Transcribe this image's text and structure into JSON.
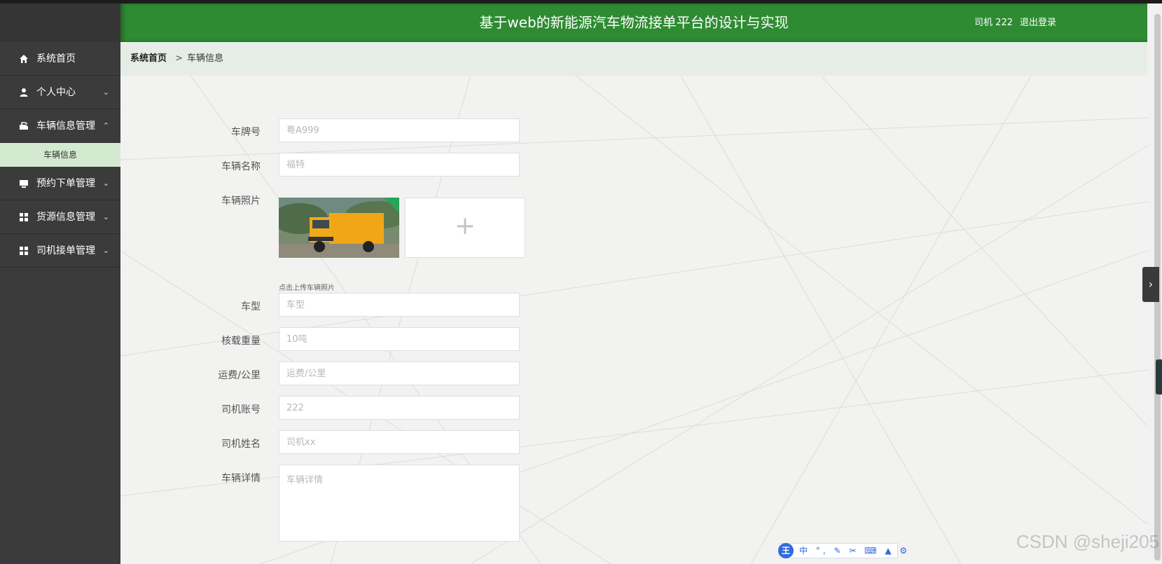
{
  "header": {
    "title": "基于web的新能源汽车物流接单平台的设计与实现",
    "user": "司机 222",
    "logout": "退出登录"
  },
  "sidebar": {
    "items": [
      {
        "label": "系统首页",
        "icon": "home-icon"
      },
      {
        "label": "个人中心",
        "icon": "user-icon",
        "chevron": "down"
      },
      {
        "label": "车辆信息管理",
        "icon": "vehicle-icon",
        "chevron": "up"
      },
      {
        "label": "预约下单管理",
        "icon": "monitor-icon",
        "chevron": "down"
      },
      {
        "label": "货源信息管理",
        "icon": "grid-icon",
        "chevron": "down"
      },
      {
        "label": "司机接单管理",
        "icon": "grid-icon",
        "chevron": "down"
      }
    ],
    "subitems": [
      {
        "label": "车辆信息",
        "active": true
      }
    ]
  },
  "breadcrumb": {
    "home": "系统首页",
    "separator": ">",
    "current": "车辆信息"
  },
  "form": {
    "plate": {
      "label": "车牌号",
      "placeholder": "粤A999"
    },
    "name": {
      "label": "车辆名称",
      "placeholder": "福特"
    },
    "photo": {
      "label": "车辆照片",
      "tip": "点击上传车辆照片",
      "upload_glyph": "+"
    },
    "type": {
      "label": "车型",
      "placeholder": "车型"
    },
    "load": {
      "label": "核载重量",
      "placeholder": "10吨"
    },
    "fee": {
      "label": "运费/公里",
      "placeholder": "运费/公里"
    },
    "account": {
      "label": "司机账号",
      "placeholder": "222"
    },
    "driver": {
      "label": "司机姓名",
      "placeholder": "司机xx"
    },
    "detail": {
      "label": "车辆详情",
      "placeholder": "车辆详情"
    }
  },
  "ime": {
    "logo": "王",
    "icons": "中 °, ✎ ✂ ⌨ ▲ ⚙"
  },
  "watermark": "CSDN @sheji205",
  "colors": {
    "header": "#2e8b32",
    "sidebar": "#3b3b3b",
    "submenu_active": "#d4ead0",
    "breadcrumb_bg": "#e6ede7"
  }
}
